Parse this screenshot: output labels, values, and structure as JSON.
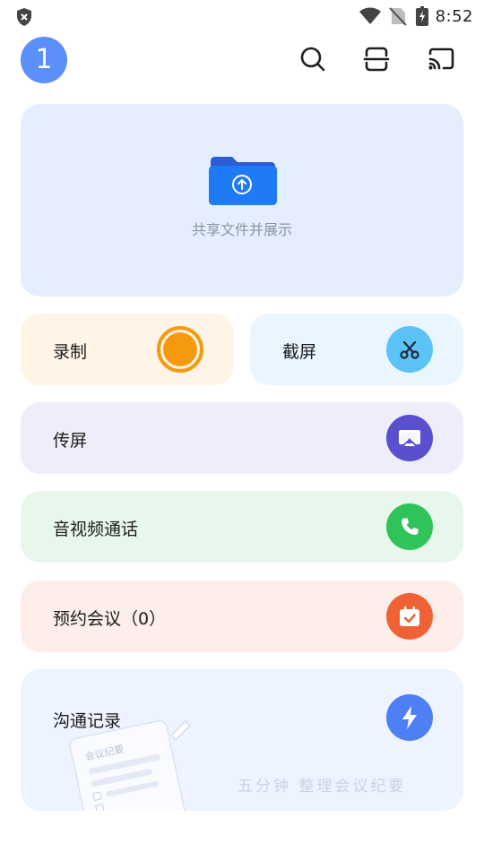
{
  "status_bar": {
    "time": "8:52",
    "icons": [
      "shield-x-icon",
      "wifi-icon",
      "no-sim-icon",
      "battery-charging-icon"
    ]
  },
  "header": {
    "avatar_text": "1",
    "icons": [
      "search-icon",
      "scan-icon",
      "cast-icon"
    ]
  },
  "upload": {
    "label": "共享文件并展示",
    "icon": "folder-upload-icon"
  },
  "actions": {
    "record": {
      "label": "录制",
      "icon": "record-icon",
      "color": "#f7990f"
    },
    "screenshot": {
      "label": "截屏",
      "icon": "scissors-icon",
      "color": "#5bc3f5"
    },
    "screen_cast": {
      "label": "传屏",
      "icon": "airplay-icon",
      "color": "#5a4fcf"
    },
    "av_call": {
      "label": "音视频通话",
      "icon": "phone-icon",
      "color": "#2fc35a"
    },
    "meeting": {
      "label": "预约会议（0）",
      "icon": "calendar-check-icon",
      "color": "#ef6236"
    },
    "notes": {
      "label": "沟通记录",
      "icon": "lightning-icon",
      "color": "#4f7ff5",
      "slogan": "五分钟 整理会议纪要",
      "illustration_text": "会议纪要"
    }
  }
}
